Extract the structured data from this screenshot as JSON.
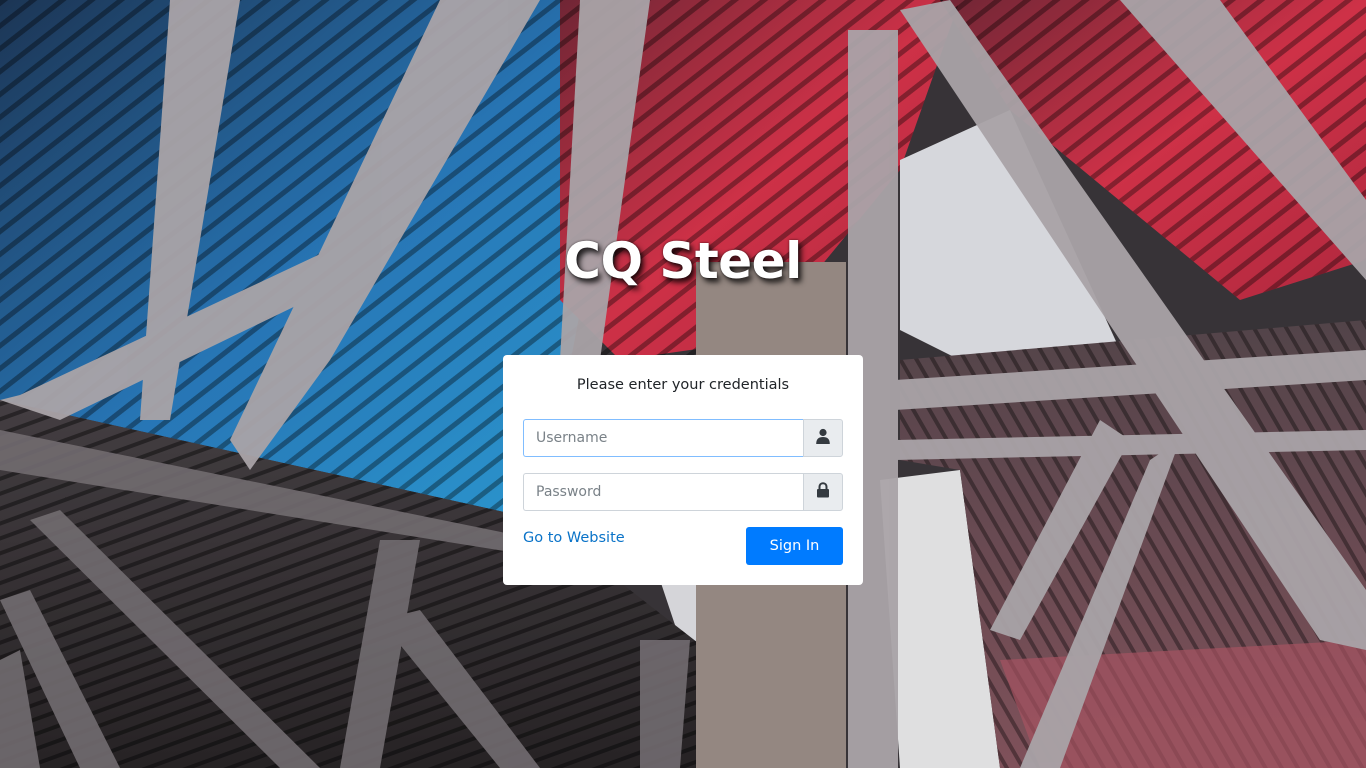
{
  "brand": {
    "title": "CQ Steel"
  },
  "login": {
    "prompt": "Please enter your credentials",
    "username": {
      "placeholder": "Username",
      "value": "",
      "icon": "user-icon"
    },
    "password": {
      "placeholder": "Password",
      "value": "",
      "icon": "lock-icon"
    },
    "website_link": "Go to Website",
    "signin_label": "Sign In"
  },
  "colors": {
    "primary": "#007bff",
    "link": "#0a73c8",
    "card_background": "#ffffff",
    "addon_background": "#e9ecef"
  }
}
